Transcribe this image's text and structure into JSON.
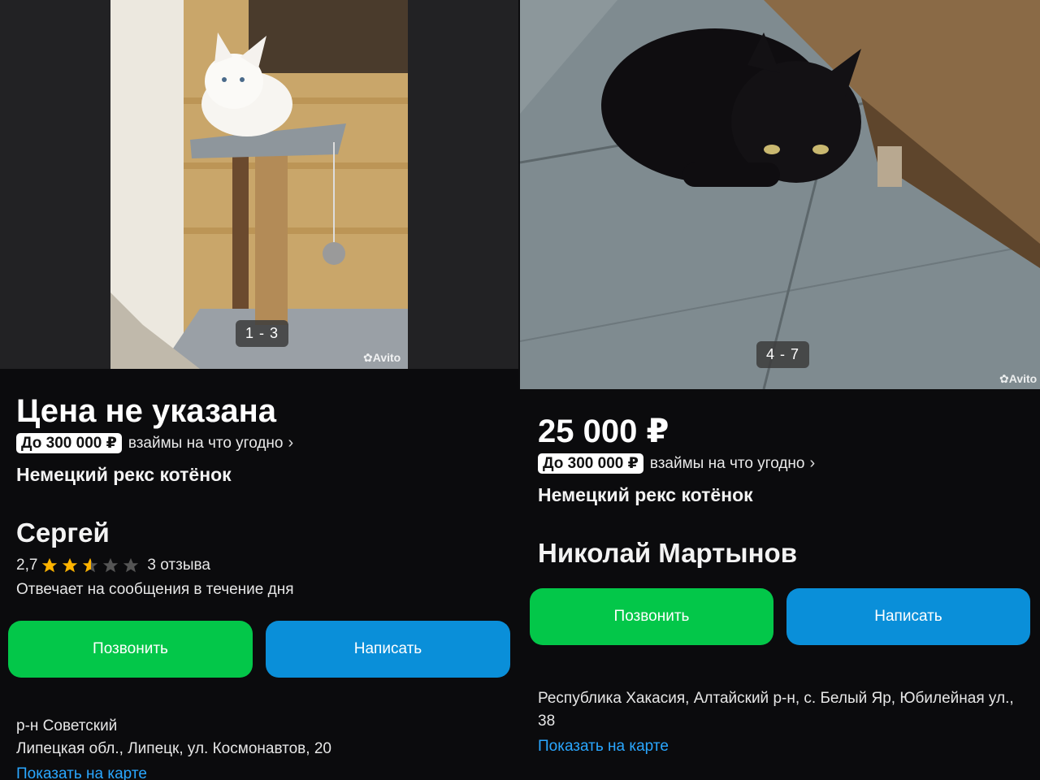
{
  "left": {
    "photo_counter": "1 - 3",
    "watermark": "Avito",
    "price": "Цена не указана",
    "loan_badge": "До 300 000 ₽",
    "loan_text": "взаймы на что угодно",
    "title": "Немецкий рекс котёнок",
    "seller_name": "Сергей",
    "rating_value": "2,7",
    "rating_stars": 2.7,
    "reviews": "3 отзыва",
    "reply_time": "Отвечает на сообщения в течение дня",
    "call_label": "Позвонить",
    "message_label": "Написать",
    "district": "р-н Советский",
    "address": "Липецкая обл., Липецк, ул. Космонавтов, 20",
    "map_link": "Показать на карте"
  },
  "right": {
    "photo_counter": "4 - 7",
    "watermark": "Avito",
    "price": "25 000 ₽",
    "loan_badge": "До 300 000 ₽",
    "loan_text": "взаймы на что угодно",
    "title": "Немецкий рекс котёнок",
    "seller_name": "Николай Мартынов",
    "call_label": "Позвонить",
    "message_label": "Написать",
    "address_line1": "Республика Хакасия, Алтайский р-н, с. Белый Яр, Юбилейная ул.,",
    "address_line2": "38",
    "map_link": "Показать на карте"
  },
  "colors": {
    "call_button": "#03c749",
    "message_button": "#0a8fd9",
    "link": "#2aa7ff",
    "star_filled": "#ffb400",
    "star_empty": "#555555"
  },
  "icons": [
    "chevron-right-icon",
    "star-icon",
    "avito-logo-icon"
  ]
}
